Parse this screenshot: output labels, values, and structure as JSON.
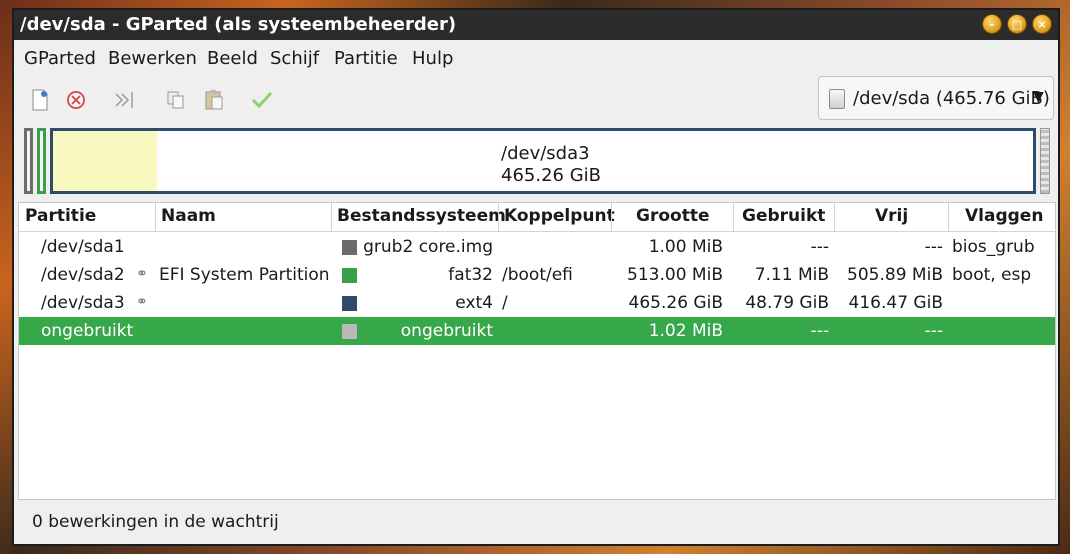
{
  "window": {
    "title": "/dev/sda - GParted (als systeembeheerder)"
  },
  "menubar": {
    "items": [
      "GParted",
      "Bewerken",
      "Beeld",
      "Schijf",
      "Partitie",
      "Hulp"
    ]
  },
  "toolbar": {
    "icons": [
      "new-partition-icon",
      "delete-icon",
      "resize-move-icon",
      "copy-icon",
      "paste-icon",
      "apply-icon"
    ]
  },
  "device_select": {
    "value": "/dev/sda (465.76 GiB)"
  },
  "disk_map": {
    "main_partition_name": "/dev/sda3",
    "main_partition_size": "465.26 GiB"
  },
  "table": {
    "headers": [
      "Partitie",
      "Naam",
      "Bestandssysteem",
      "Koppelpunt",
      "Grootte",
      "Gebruikt",
      "Vrij",
      "Vlaggen"
    ],
    "rows": [
      {
        "partition": "/dev/sda1",
        "name": "",
        "fs": "grub2 core.img",
        "fs_color": "#6b6b6b",
        "mount": "",
        "size": "1.00 MiB",
        "used": "---",
        "free": "---",
        "flags": "bios_grub",
        "key": false
      },
      {
        "partition": "/dev/sda2",
        "name": "EFI System Partition",
        "fs": "fat32",
        "fs_color": "#3aa048",
        "mount": "/boot/efi",
        "size": "513.00 MiB",
        "used": "7.11 MiB",
        "free": "505.89 MiB",
        "flags": "boot, esp",
        "key": true
      },
      {
        "partition": "/dev/sda3",
        "name": "",
        "fs": "ext4",
        "fs_color": "#2f4b6b",
        "mount": "/",
        "size": "465.26 GiB",
        "used": "48.79 GiB",
        "free": "416.47 GiB",
        "flags": "",
        "key": true
      },
      {
        "partition": "ongebruikt",
        "name": "",
        "fs": "ongebruikt",
        "fs_color": "#b8b8b8",
        "mount": "",
        "size": "1.02 MiB",
        "used": "---",
        "free": "---",
        "flags": "",
        "key": false
      }
    ]
  },
  "status": {
    "text": "0 bewerkingen in de wachtrij"
  }
}
